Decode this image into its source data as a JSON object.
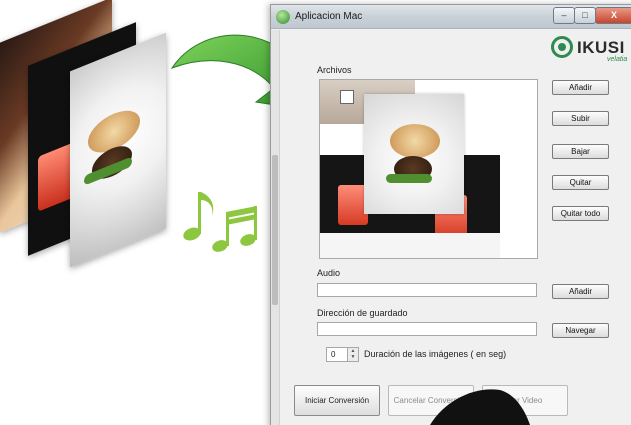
{
  "window": {
    "title": "Aplicacion Mac",
    "controls": [
      "–",
      "□",
      "X"
    ]
  },
  "logo": {
    "text": "IKUSI",
    "subtext": "velatia"
  },
  "files_label": "Archivos",
  "file_buttons": [
    "Añadir",
    "Subir",
    "Bajar",
    "Quitar",
    "Quitar todo"
  ],
  "audio": {
    "label": "Audio",
    "value": "",
    "button": "Añadir"
  },
  "save_dir": {
    "label": "Dirección de guardado",
    "value": "",
    "button": "Navegar"
  },
  "duration": {
    "value": "0",
    "label": "Duración de las imágenes ( en seg)"
  },
  "actions": {
    "start": "Iniciar Conversión",
    "cancel": "Cancelar Conversión",
    "view": "Ver Video"
  },
  "colors": {
    "brand_green": "#2f8a4f",
    "arrow_green": "#3fae3a",
    "music_green": "#8dc63f"
  }
}
